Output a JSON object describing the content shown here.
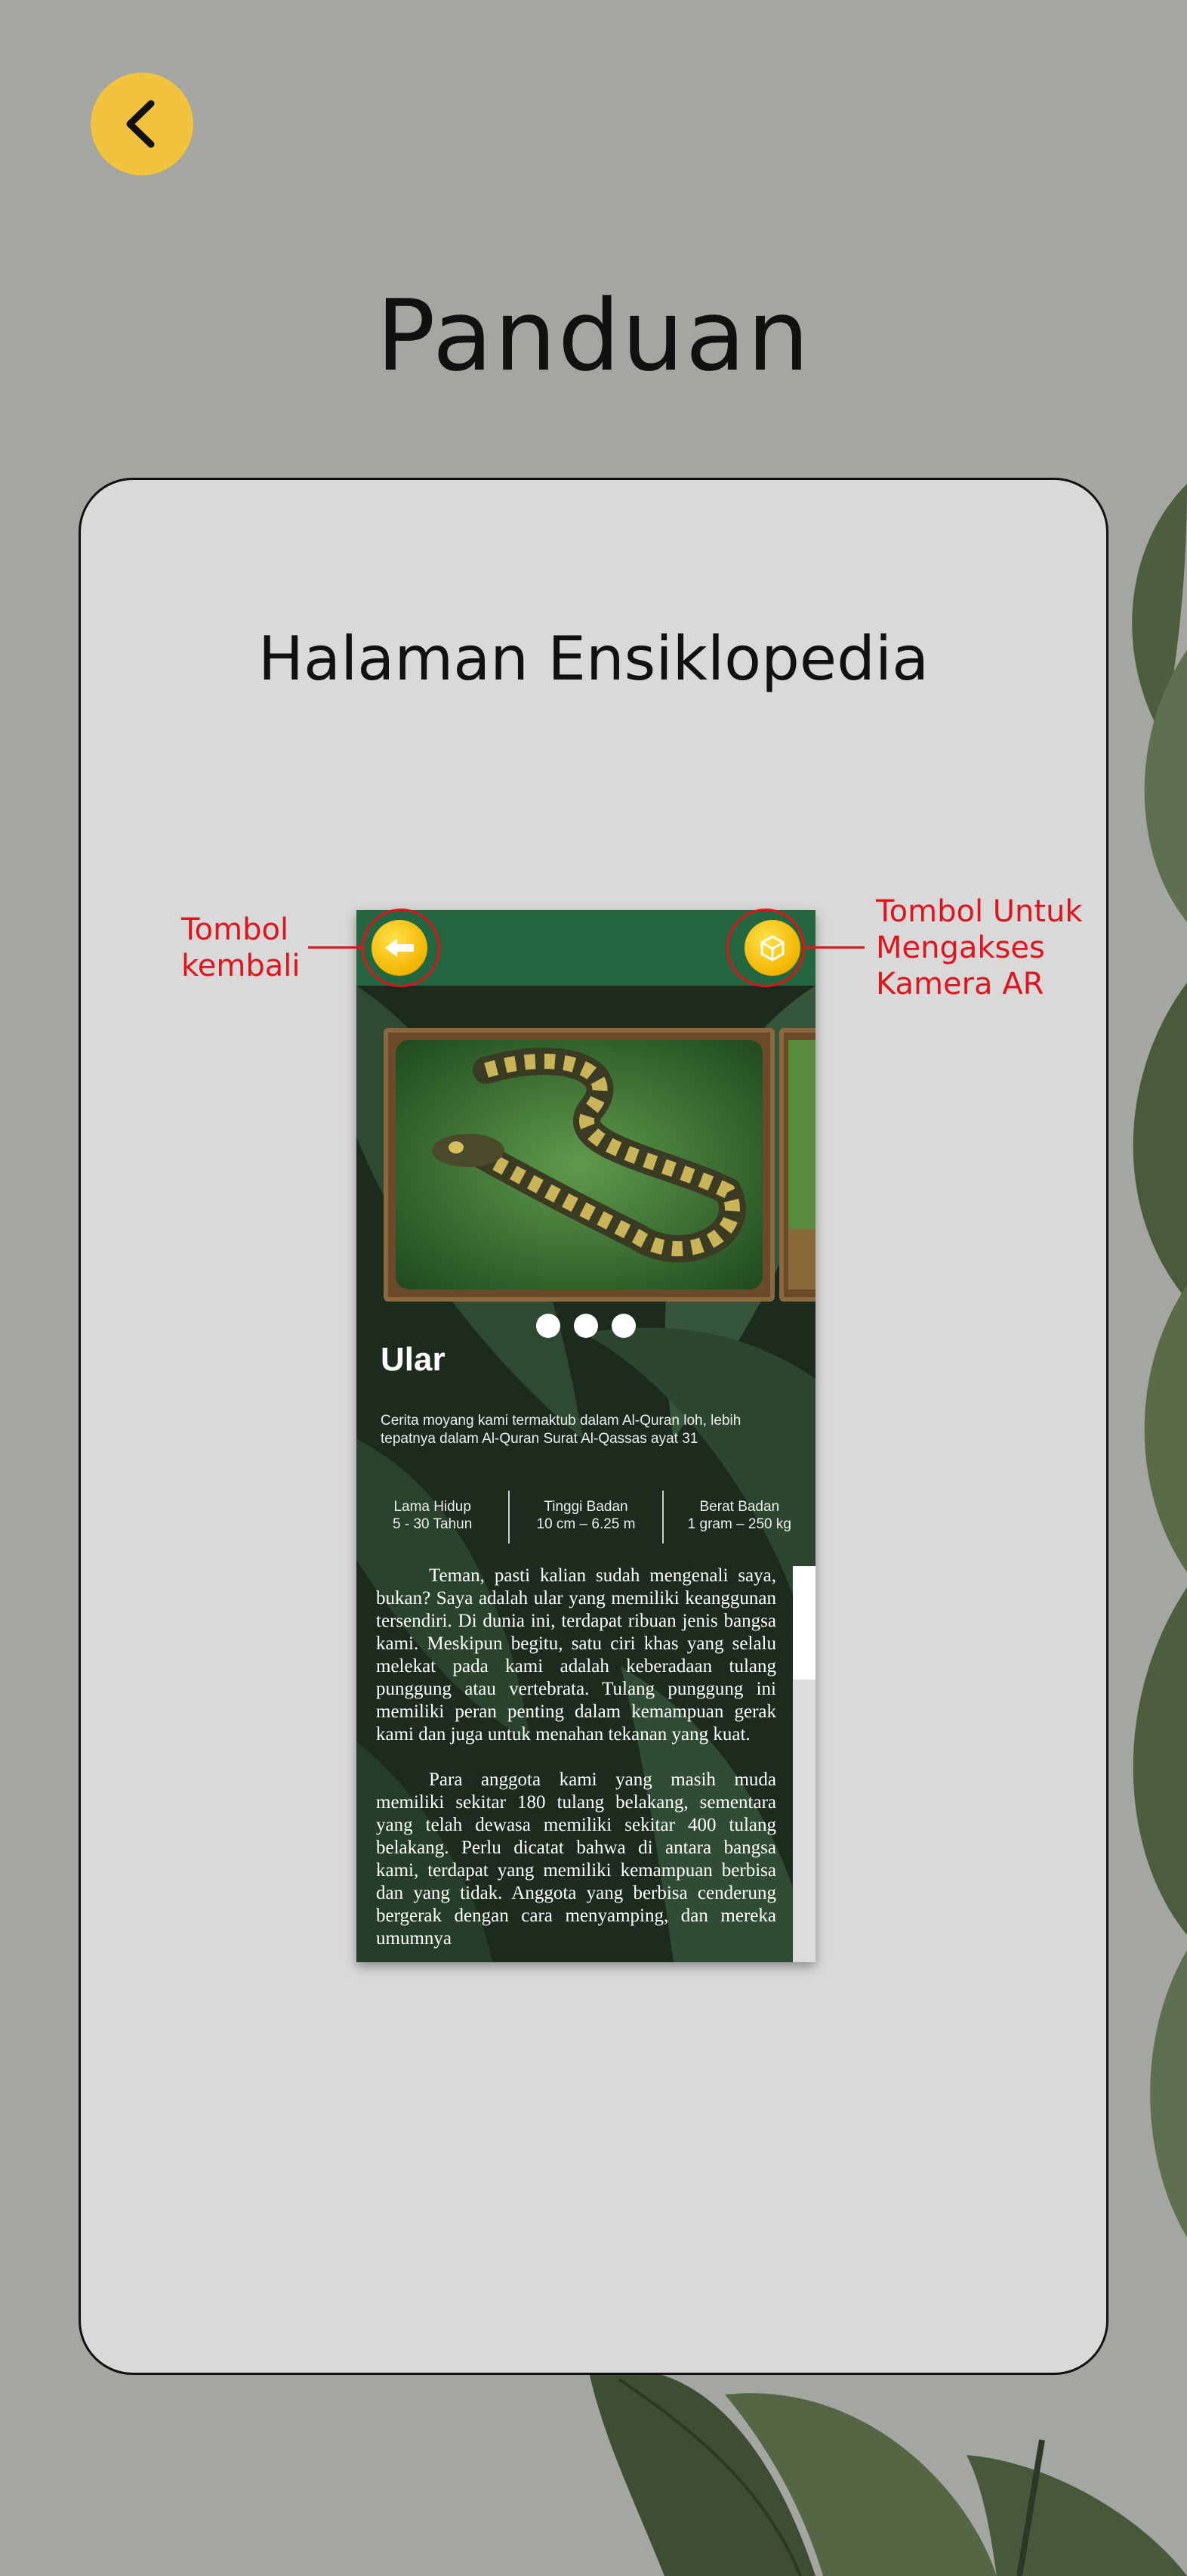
{
  "header": {
    "title": "Panduan",
    "back_icon": "chevron-left-icon"
  },
  "card": {
    "title": "Halaman Ensiklopedia"
  },
  "phone": {
    "back_icon": "arrow-left-icon",
    "ar_icon": "ar-cube-icon",
    "carousel_dots": 3,
    "animal_name": "Ular",
    "description": "Cerita moyang kami termaktub dalam Al-Quran loh, lebih tepatnya dalam Al-Quran Surat Al-Qassas ayat 31",
    "stats": [
      {
        "label": "Lama Hidup",
        "value": "5 - 30 Tahun"
      },
      {
        "label": "Tinggi Badan",
        "value": "10 cm – 6.25 m"
      },
      {
        "label": "Berat Badan",
        "value": "1 gram – 250 kg"
      }
    ],
    "paragraphs": [
      "Teman, pasti kalian sudah mengenali saya, bukan? Saya adalah ular yang memiliki keanggunan tersendiri. Di dunia ini, terdapat ribuan jenis bangsa kami. Meskipun begitu, satu ciri khas yang selalu melekat pada kami adalah keberadaan tulang punggung atau vertebrata. Tulang punggung ini memiliki peran penting dalam kemampuan gerak kami dan juga untuk menahan tekanan yang kuat.",
      "Para anggota kami yang masih muda memiliki sekitar 180 tulang belakang, sementara yang telah dewasa memiliki sekitar 400 tulang belakang. Perlu dicatat bahwa di antara bangsa kami, terdapat yang memiliki kemampuan berbisa dan yang tidak. Anggota yang berbisa cenderung bergerak dengan cara menyamping, dan mereka umumnya"
    ]
  },
  "annotations": {
    "back": "Tombol\nkembali",
    "back_lines": [
      "Tombol",
      "kembali"
    ],
    "ar_lines": [
      "Tombol Untuk",
      "Mengakses",
      "Kamera AR"
    ]
  },
  "colors": {
    "background": "#a3a6a1",
    "card": "#d9d9d9",
    "accent_yellow": "#f1c23e",
    "phone_header": "#23663f",
    "annotation_red": "#e0141c"
  }
}
